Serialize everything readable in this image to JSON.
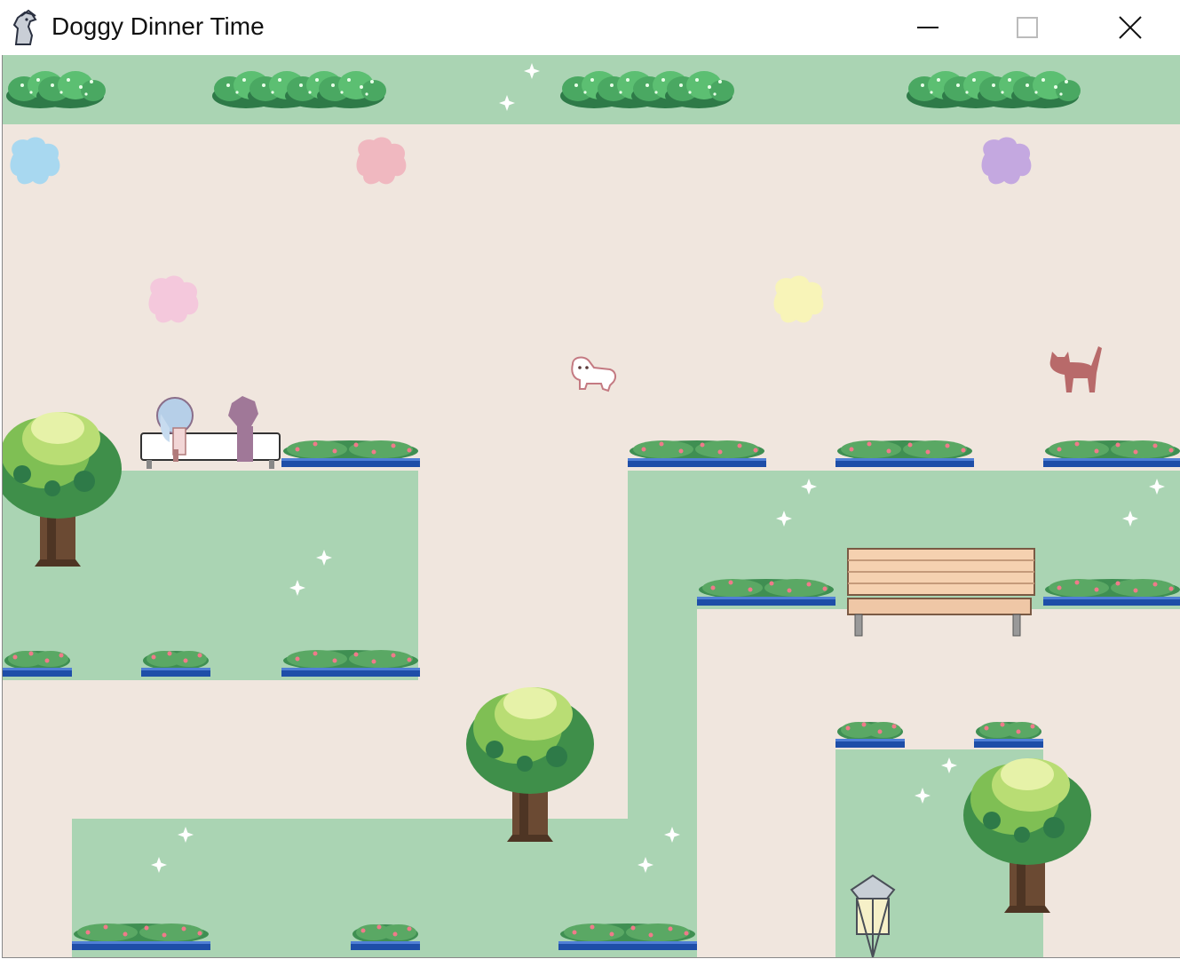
{
  "window": {
    "title": "Doggy Dinner Time",
    "app_icon": "horse-icon",
    "controls": {
      "minimize": "minimize-icon",
      "maximize": "maximize-icon",
      "close": "close-icon"
    }
  },
  "scene": {
    "colors": {
      "path": "#f0e6de",
      "grass": "#aad4b3",
      "hedge_light": "#7fd88a",
      "hedge_dark": "#2e7a48",
      "planter_blue": "#1e4ea8",
      "ghost_blue": "#a8d8f0",
      "ghost_pink": "#f0b8c0",
      "ghost_lightpink": "#f4c8dc",
      "ghost_yellow": "#f8f4b8",
      "ghost_purple": "#c4a8e0",
      "cat": "#b86a6a",
      "player_dog": "#ffffff"
    },
    "characters": [
      {
        "kind": "ghost-dog",
        "color": "blue"
      },
      {
        "kind": "ghost-dog",
        "color": "pink"
      },
      {
        "kind": "ghost-dog",
        "color": "purple"
      },
      {
        "kind": "ghost-dog",
        "color": "light-pink"
      },
      {
        "kind": "ghost-dog",
        "color": "yellow"
      },
      {
        "kind": "player-dog",
        "color": "white"
      },
      {
        "kind": "cat",
        "color": "brown"
      },
      {
        "kind": "girl-on-bench",
        "color": "lavender"
      }
    ],
    "props": [
      "trees",
      "benches",
      "flower-planters",
      "hedges",
      "lamp-post",
      "sparkles"
    ]
  }
}
